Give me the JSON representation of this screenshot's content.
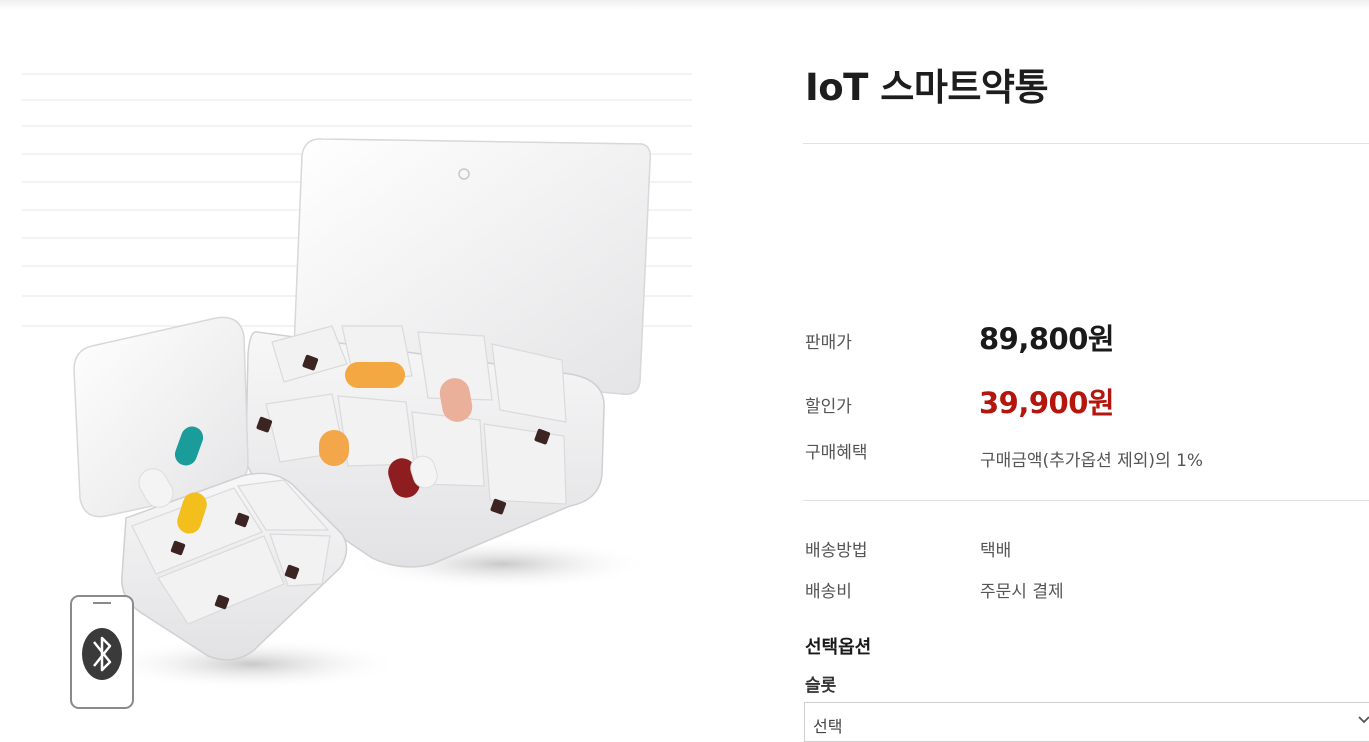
{
  "product": {
    "title": "IoT 스마트약통",
    "image_alt": "IoT smart pill box with bluetooth",
    "icon": "bluetooth-icon"
  },
  "price": {
    "sale_label": "판매가",
    "sale_value": "89,800원",
    "discount_label": "할인가",
    "discount_value": "39,900원",
    "benefit_label": "구매혜택",
    "benefit_value": "구매금액(추가옵션 제외)의 1%"
  },
  "shipping": {
    "method_label": "배송방법",
    "method_value": "택배",
    "fee_label": "배송비",
    "fee_value": "주문시 결제"
  },
  "options": {
    "section_title": "선택옵션",
    "slot_label": "슬롯",
    "slot_selected": "선택"
  },
  "colors": {
    "discount": "#b4160e",
    "divider": "#e1e1e1"
  }
}
